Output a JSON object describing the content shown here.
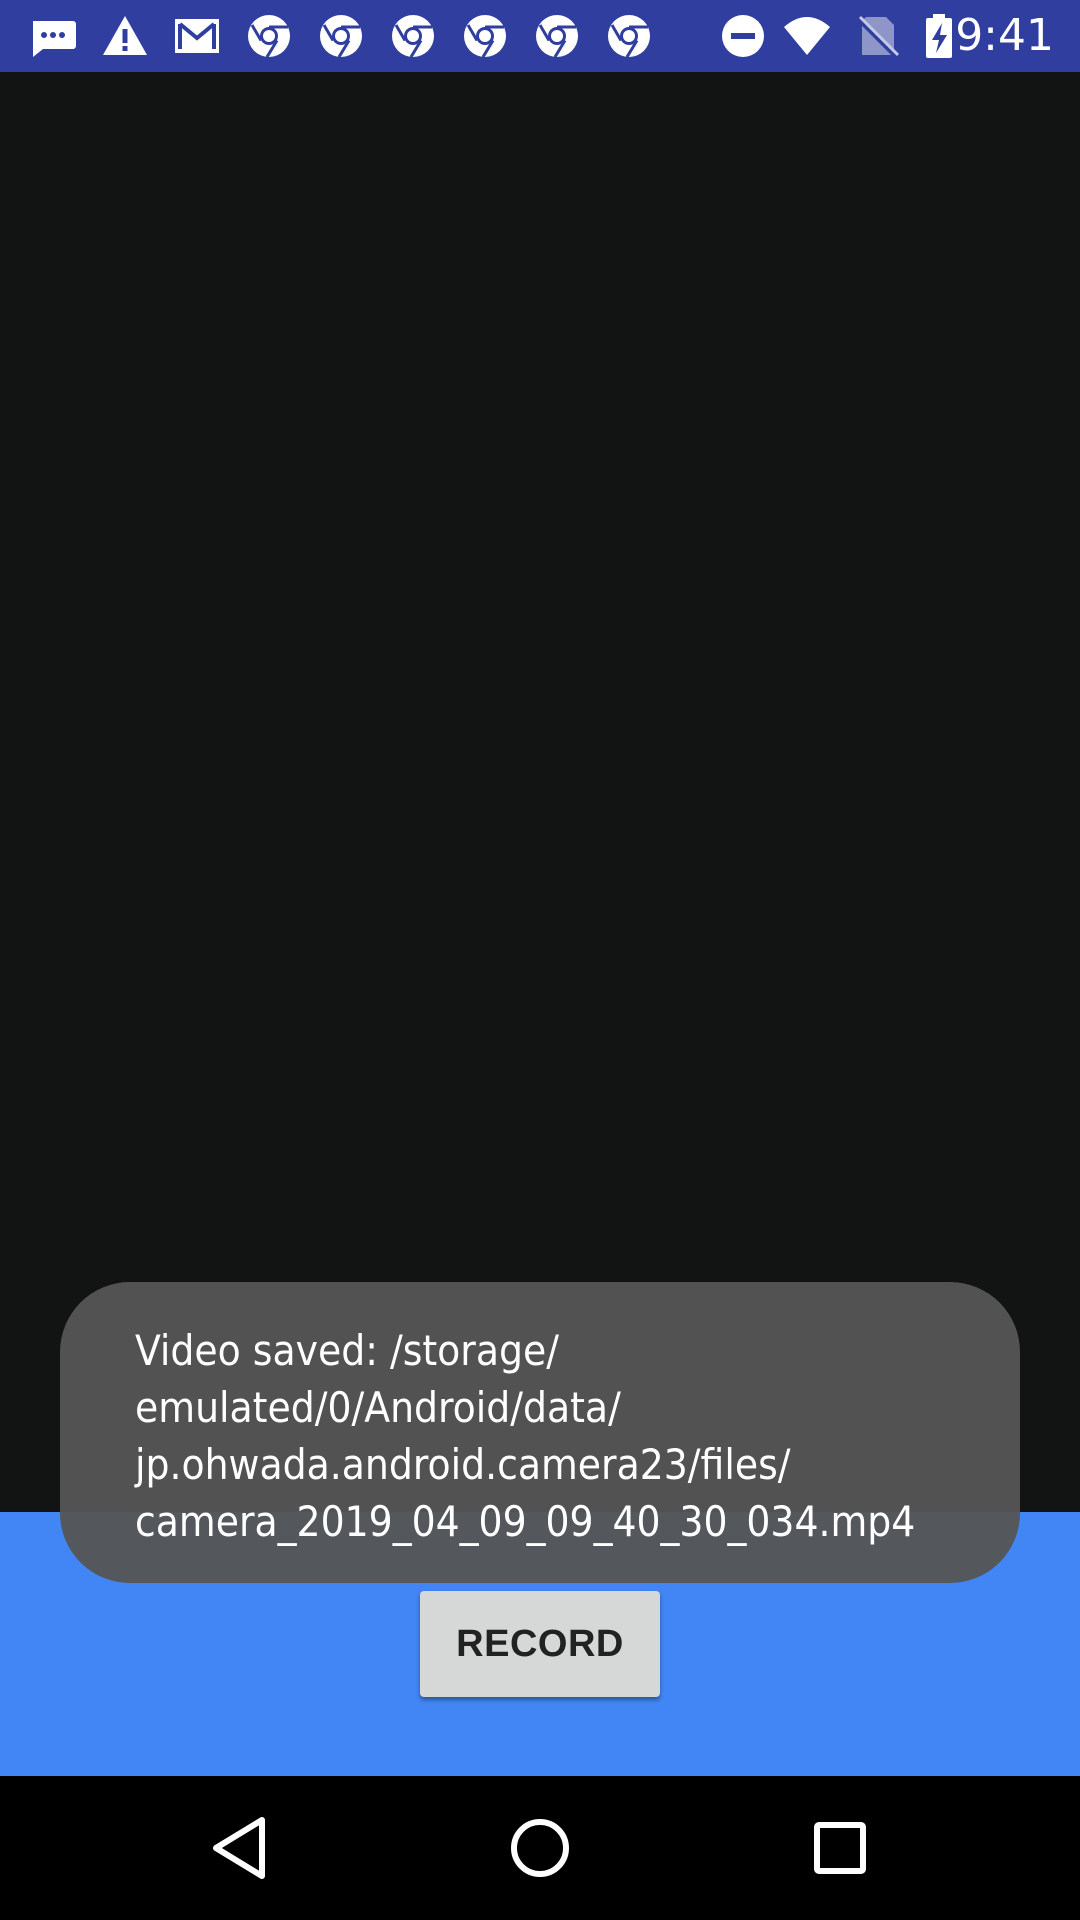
{
  "status_bar": {
    "time": "9:41",
    "left_icons": [
      "messages-icon",
      "warning-icon",
      "gmail-icon",
      "chrome-icon",
      "chrome-icon",
      "chrome-icon",
      "chrome-icon",
      "chrome-icon",
      "chrome-icon"
    ],
    "right_icons": [
      "do-not-disturb-icon",
      "wifi-icon",
      "no-sim-icon",
      "battery-charging-icon"
    ],
    "background_color": "#303F9F"
  },
  "preview": {
    "background_color": "#121313"
  },
  "toast": {
    "lines": [
      "Video saved: /storage/",
      "emulated/0/Android/data/",
      "jp.ohwada.android.camera23/files/",
      "camera_2019_04_09_09_40_30_034.mp4"
    ]
  },
  "controls": {
    "background_color": "#4285F4",
    "record_label": "RECORD"
  },
  "nav_bar": {
    "buttons": [
      "back-icon",
      "home-icon",
      "recents-icon"
    ]
  }
}
